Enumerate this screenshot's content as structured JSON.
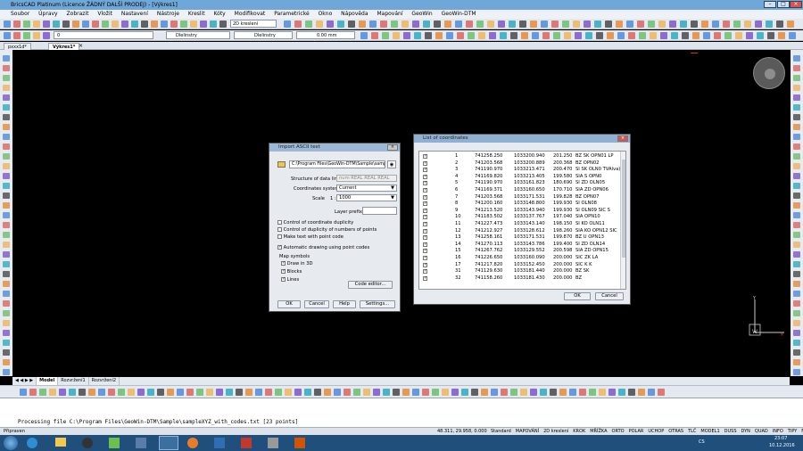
{
  "app": {
    "title": "BricsCAD Platinum (Licence ŽÁDNÝ DALŠÍ PRODEJ) - [Výkres1]"
  },
  "menu": [
    "Soubor",
    "Úpravy",
    "Zobrazit",
    "Vložit",
    "Nastavení",
    "Nástroje",
    "Kreslit",
    "Kóty",
    "Modifikovat",
    "Parametrické",
    "Okno",
    "Nápověda",
    "Mapování",
    "GeoWin",
    "GeoWin-DTM"
  ],
  "toolbar": {
    "view_select": "2D kreslení",
    "layer_value": "0",
    "color_value": "Dlelinstry",
    "linetype_value": "Dlelinstry",
    "lineweight_value": "0.00 mm"
  },
  "file_tabs": [
    "pxxx1d*",
    "Výkres1*"
  ],
  "layout_tabs": [
    "Model",
    "Rozvržení1",
    "Rozvržení2"
  ],
  "command": {
    "lines": [
      "Processing file C:\\Program Files\\GeoWin-DTM\\Sample\\sampleXYZ_with_codes.txt  [23 points]"
    ]
  },
  "status": {
    "ready": "Připraven",
    "coords": "48.311, 29.958, 0.000",
    "items": [
      "Standard",
      "MAPOVÁNÍ",
      "2D kreslení",
      "KROK",
      "MŘÍŽKA",
      "ORTO",
      "POLAR",
      "UCHOP",
      "OTRAS",
      "TLČ",
      "MODEL1",
      "DUSS",
      "DYN",
      "QUAD",
      "INFO",
      "TIPY",
      "Nic"
    ]
  },
  "taskbar": {
    "lang": "CS",
    "time": "23:07",
    "date": "10.12.2016"
  },
  "import_dialog": {
    "title": "Import ASCII text",
    "path": "C:\\Program Files\\GeoWin-DTM\\Sample\\sample",
    "structure_label": "Structure of data line",
    "structure_value": "num REAL REAL REAL",
    "coord_system_label": "Coordinates system",
    "coord_system_value": "Current",
    "scale_label": "Scale",
    "scale_prefix": "1 :",
    "scale_value": "1000",
    "layer_prefix_label": "Layer prefix",
    "checks": [
      {
        "label": "Control of coordinate duplicity",
        "checked": false
      },
      {
        "label": "Control of duplicity of numbers of points",
        "checked": false
      },
      {
        "label": "Make text with point code",
        "checked": false
      },
      {
        "label": "Automatic drawing using point codes",
        "checked": true
      }
    ],
    "map_symbols_label": "Map symbols",
    "map_checks": [
      {
        "label": "Draw in 3D",
        "checked": true
      },
      {
        "label": "Blocks",
        "checked": true
      },
      {
        "label": "Lines",
        "checked": true
      }
    ],
    "code_editor": "Code editor...",
    "buttons": {
      "ok": "OK",
      "cancel": "Cancel",
      "help": "Help",
      "settings": "Settings..."
    }
  },
  "coord_dialog": {
    "title": "List of coordinates",
    "rows": [
      {
        "num": "1",
        "y": "741258.250",
        "x": "1033200.940",
        "z": "201.250",
        "code": "BZ SK OPN01 LP"
      },
      {
        "num": "2",
        "y": "741203.568",
        "x": "1033200.889",
        "z": "200.368",
        "code": "BZ OPN02"
      },
      {
        "num": "3",
        "y": "741190.970",
        "x": "1033213.471",
        "z": "200.470",
        "code": "SI SK OLN0 TVAlva)"
      },
      {
        "num": "4",
        "y": "741169.820",
        "x": "1033213.405",
        "z": "199.580",
        "code": "SIA S OPN0"
      },
      {
        "num": "5",
        "y": "741190.970",
        "x": "1033161.823",
        "z": "180.690",
        "code": "SI ZD OLN05"
      },
      {
        "num": "6",
        "y": "741169.371",
        "x": "1033160.650",
        "z": "170.710",
        "code": "SIA ZD OPN06"
      },
      {
        "num": "7",
        "y": "741203.568",
        "x": "1033171.531",
        "z": "199.828",
        "code": "BZ OPN07"
      },
      {
        "num": "8",
        "y": "741200.160",
        "x": "1033148.800",
        "z": "199.930",
        "code": "SI OLN08"
      },
      {
        "num": "9",
        "y": "741213.520",
        "x": "1033143.940",
        "z": "199.930",
        "code": "SI OLN09 SIC S"
      },
      {
        "num": "10",
        "y": "741183.502",
        "x": "1033137.767",
        "z": "197.040",
        "code": "SIA OPN10"
      },
      {
        "num": "11",
        "y": "741227.473",
        "x": "1033143.140",
        "z": "198.150",
        "code": "SI KO OLN11"
      },
      {
        "num": "12",
        "y": "741212.927",
        "x": "1033128.612",
        "z": "198.260",
        "code": "SIA KO OPN12 SIC"
      },
      {
        "num": "13",
        "y": "741258.161",
        "x": "1033171.531",
        "z": "199.870",
        "code": "BZ U OPN13"
      },
      {
        "num": "14",
        "y": "741270.113",
        "x": "1033143.786",
        "z": "199.400",
        "code": "SI ZD OLN14"
      },
      {
        "num": "15",
        "y": "741267.762",
        "x": "1033129.552",
        "z": "200.598",
        "code": "SIA ZD OPN15"
      },
      {
        "num": "16",
        "y": "741226.650",
        "x": "1033160.090",
        "z": "200.000",
        "code": "SIC ZK LA"
      },
      {
        "num": "17",
        "y": "741217.820",
        "x": "1033152.450",
        "z": "200.000",
        "code": "SIC K K"
      },
      {
        "num": "31",
        "y": "741129.630",
        "x": "1033181.440",
        "z": "200.000",
        "code": "BZ SK"
      },
      {
        "num": "32",
        "y": "741158.260",
        "x": "1033181.430",
        "z": "200.000",
        "code": "BZ"
      }
    ],
    "buttons": {
      "ok": "OK",
      "cancel": "Cancel"
    }
  }
}
